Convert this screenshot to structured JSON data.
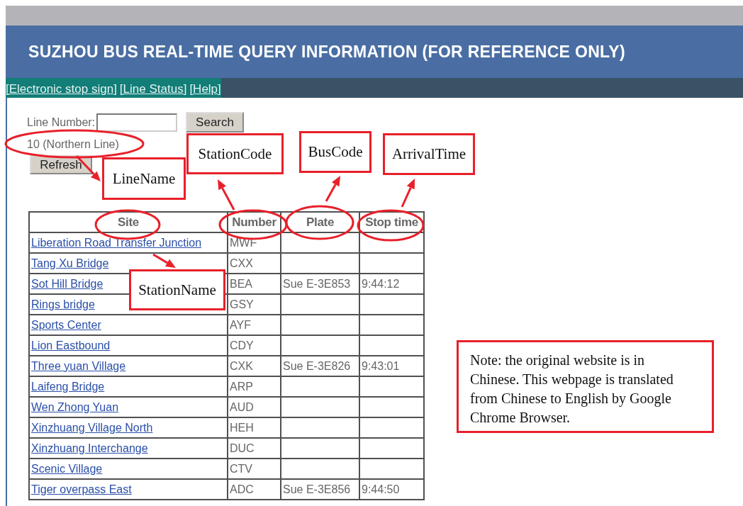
{
  "header": {
    "title": "SUZHOU BUS REAL-TIME QUERY INFORMATION (FOR REFERENCE ONLY)"
  },
  "nav_links": [
    "[Electronic stop sign]",
    "[Line Status]",
    "[Help]"
  ],
  "form": {
    "line_number_label": "Line Number:",
    "search_button": "Search",
    "line_name": "10 (Northern Line)",
    "refresh_button": "Refresh"
  },
  "table": {
    "columns": [
      "Site",
      "Number",
      "Plate",
      "Stop time"
    ],
    "rows": [
      {
        "site": "Liberation Road Transfer Junction",
        "number": "MWF"
      },
      {
        "site": "Tang Xu Bridge",
        "number": "CXX"
      },
      {
        "site": "Sot Hill Bridge",
        "number": "BEA",
        "plate": "Sue E-3E853",
        "stop_time": "9:44:12"
      },
      {
        "site": "Rings bridge",
        "number": "GSY"
      },
      {
        "site": "Sports Center",
        "number": "AYF"
      },
      {
        "site": "Lion Eastbound",
        "number": "CDY"
      },
      {
        "site": "Three yuan Village",
        "number": "CXK",
        "plate": "Sue E-3E826",
        "stop_time": "9:43:01"
      },
      {
        "site": "Laifeng Bridge",
        "number": "ARP"
      },
      {
        "site": "Wen Zhong Yuan",
        "number": "AUD"
      },
      {
        "site": "Xinzhuang Village North",
        "number": "HEH"
      },
      {
        "site": "Xinzhuang Interchange",
        "number": "DUC"
      },
      {
        "site": "Scenic Village",
        "number": "CTV"
      },
      {
        "site": "Tiger overpass East",
        "number": "ADC",
        "plate": "Sue E-3E856",
        "stop_time": "9:44:50"
      }
    ]
  },
  "annotations": [
    {
      "label": "LineName"
    },
    {
      "label": "StationCode"
    },
    {
      "label": "BusCode"
    },
    {
      "label": "ArrivalTime"
    },
    {
      "label": "StationName"
    }
  ],
  "note": "Note: the original website is in Chinese. This webpage is translated from Chinese to English by Google Chrome Browser."
}
